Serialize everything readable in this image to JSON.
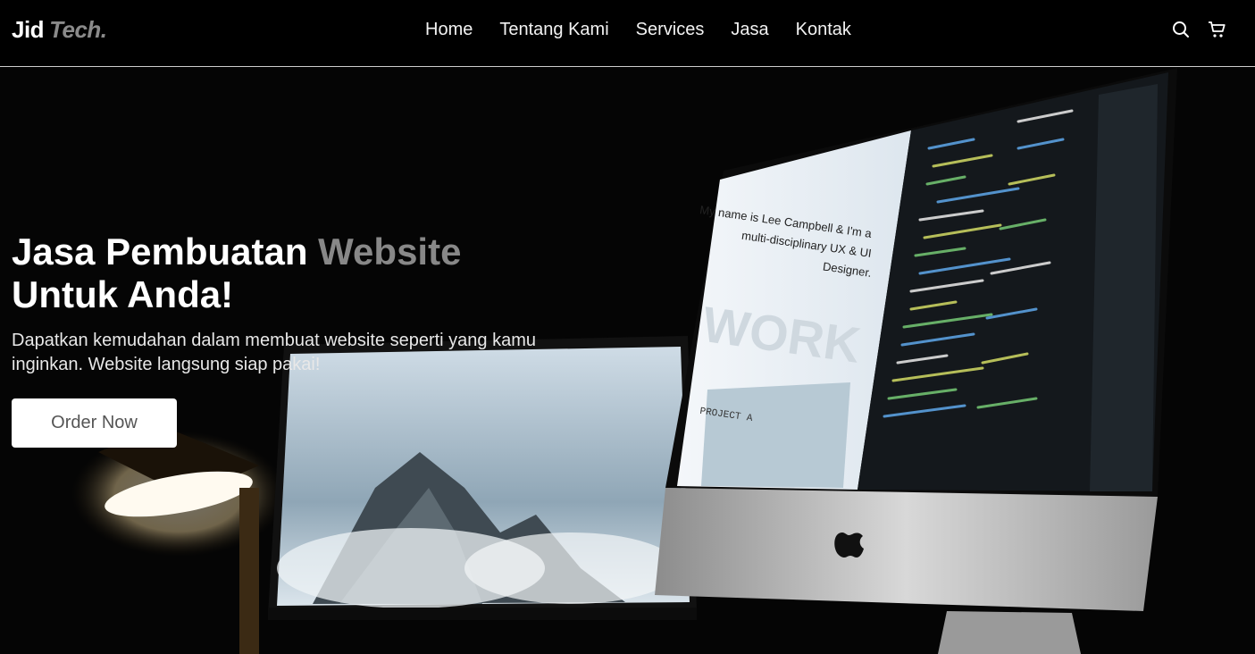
{
  "logo": {
    "part1": "Jid",
    "part2": "Tech."
  },
  "nav": {
    "items": [
      {
        "label": "Home"
      },
      {
        "label": "Tentang Kami"
      },
      {
        "label": "Services"
      },
      {
        "label": "Jasa"
      },
      {
        "label": "Kontak"
      }
    ],
    "icons": [
      "search-icon",
      "cart-icon"
    ]
  },
  "hero": {
    "title_line1_plain": "Jasa Pembuatan",
    "title_line1_accent": "Website",
    "title_line2": "Untuk Anda!",
    "description": "Dapatkan kemudahan dalam membuat website seperti yang kamu inginkan. Website langsung siap pakai!",
    "button_label": "Order Now"
  },
  "monitor_screen": {
    "intro": "My name is Lee Campbell & I'm a multi-disciplinary UX & UI Designer.",
    "watermark": "WORK",
    "project_label": "PROJECT A"
  },
  "colors": {
    "background": "#000000",
    "accent_gray": "#888888",
    "nav_border": "#cfcfcf",
    "button_bg": "#ffffff",
    "button_text": "#555555"
  }
}
